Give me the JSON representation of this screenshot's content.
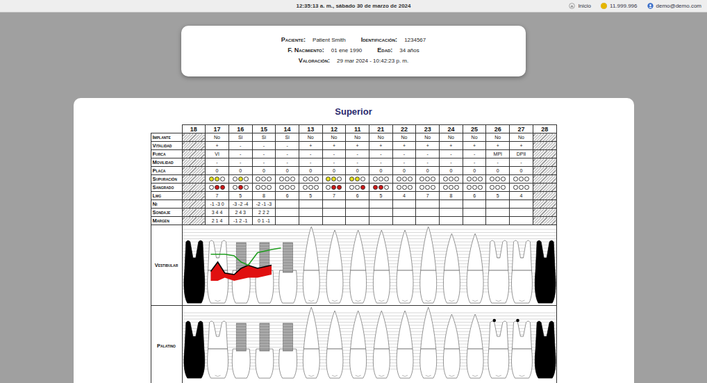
{
  "topbar": {
    "datetime": "12:35:13 a. m., sábado 30 de marzo de 2024",
    "links": [
      {
        "label": "Inicio"
      },
      {
        "label": "11.999.996"
      },
      {
        "label": "demo@demo.com"
      }
    ]
  },
  "patient": {
    "rows": [
      [
        {
          "label": "Paciente:",
          "value": "Patient Smith"
        },
        {
          "label": "Identificación:",
          "value": "1234567"
        }
      ],
      [
        {
          "label": "F. Nacimiento:",
          "value": "01 ene 1990"
        },
        {
          "label": "Edad:",
          "value": "34 años"
        }
      ],
      [
        {
          "label": "Valoración:",
          "value": "29 mar 2024 - 10:42:23 p. m."
        }
      ]
    ]
  },
  "chart": {
    "title": "Superior",
    "teeth": [
      {
        "number": "18",
        "missing": true,
        "kind": "missing",
        "palatal_dot": false
      },
      {
        "number": "17",
        "missing": false,
        "kind": "molar",
        "palatal_dot": false
      },
      {
        "number": "16",
        "missing": false,
        "kind": "implant",
        "palatal_dot": false
      },
      {
        "number": "15",
        "missing": false,
        "kind": "implant",
        "palatal_dot": false
      },
      {
        "number": "14",
        "missing": false,
        "kind": "implant",
        "palatal_dot": false
      },
      {
        "number": "13",
        "missing": false,
        "kind": "canine",
        "palatal_dot": false
      },
      {
        "number": "12",
        "missing": false,
        "kind": "incisor",
        "palatal_dot": false
      },
      {
        "number": "11",
        "missing": false,
        "kind": "incisor",
        "palatal_dot": false
      },
      {
        "number": "21",
        "missing": false,
        "kind": "incisor",
        "palatal_dot": false
      },
      {
        "number": "22",
        "missing": false,
        "kind": "incisor",
        "palatal_dot": false
      },
      {
        "number": "23",
        "missing": false,
        "kind": "canine",
        "palatal_dot": false
      },
      {
        "number": "24",
        "missing": false,
        "kind": "premolar",
        "palatal_dot": false
      },
      {
        "number": "25",
        "missing": false,
        "kind": "premolar",
        "palatal_dot": false
      },
      {
        "number": "26",
        "missing": false,
        "kind": "molar",
        "palatal_dot": true
      },
      {
        "number": "27",
        "missing": false,
        "kind": "molar",
        "palatal_dot": true
      },
      {
        "number": "28",
        "missing": true,
        "kind": "missing",
        "palatal_dot": false
      }
    ],
    "rows": [
      {
        "label": "Implante",
        "kind": "text",
        "cells": [
          null,
          "No",
          "Si",
          "Si",
          "Si",
          "No",
          "No",
          "No",
          "No",
          "No",
          "No",
          "No",
          "No",
          "No",
          "No",
          null
        ]
      },
      {
        "label": "Vitalidad",
        "kind": "text",
        "cells": [
          null,
          "+",
          "-",
          "-",
          "-",
          "+",
          "+",
          "+",
          "+",
          "+",
          "+",
          "+",
          "+",
          "+",
          "+",
          null
        ]
      },
      {
        "label": "Furca",
        "kind": "text",
        "cells": [
          null,
          "VI",
          "-",
          "-",
          "-",
          "-",
          "-",
          "-",
          "-",
          "-",
          "-",
          "-",
          "-",
          "MPI",
          "DPII",
          null
        ]
      },
      {
        "label": "Movilidad",
        "kind": "text",
        "cells": [
          null,
          "-",
          "-",
          "-",
          "-",
          "-",
          "-",
          "-",
          "-",
          "-",
          "-",
          "-",
          "-",
          "-",
          "-",
          null
        ]
      },
      {
        "label": "Placa",
        "kind": "text",
        "cells": [
          null,
          "0",
          "0",
          "0",
          "0",
          "0",
          "0",
          "0",
          "0",
          "0",
          "0",
          "0",
          "0",
          "0",
          "0",
          null
        ]
      },
      {
        "label": "Supuración",
        "kind": "dots",
        "color": "#e6e020",
        "cells": [
          null,
          [
            true,
            true,
            false
          ],
          [
            false,
            true,
            false
          ],
          [
            false,
            false,
            false
          ],
          [
            false,
            false,
            false
          ],
          [
            false,
            false,
            false
          ],
          [
            true,
            true,
            false
          ],
          [
            true,
            true,
            false
          ],
          [
            false,
            false,
            false
          ],
          [
            false,
            false,
            false
          ],
          [
            false,
            false,
            false
          ],
          [
            false,
            false,
            false
          ],
          [
            false,
            false,
            false
          ],
          [
            false,
            false,
            false
          ],
          [
            false,
            false,
            false
          ],
          null
        ]
      },
      {
        "label": "Sangrado",
        "kind": "dots",
        "color": "#d01818",
        "cells": [
          null,
          [
            false,
            true,
            true
          ],
          [
            false,
            true,
            false
          ],
          [
            false,
            false,
            false
          ],
          [
            false,
            false,
            false
          ],
          [
            false,
            false,
            false
          ],
          [
            false,
            true,
            true
          ],
          [
            false,
            false,
            true
          ],
          [
            true,
            true,
            false
          ],
          [
            false,
            false,
            false
          ],
          [
            false,
            false,
            false
          ],
          [
            false,
            false,
            false
          ],
          [
            false,
            false,
            false
          ],
          [
            false,
            false,
            false
          ],
          [
            false,
            false,
            false
          ],
          null
        ]
      },
      {
        "label": "Lmg",
        "kind": "text",
        "cells": [
          null,
          "7",
          "5",
          "8",
          "6",
          "5",
          "7",
          "6",
          "5",
          "4",
          "7",
          "8",
          "6",
          "5",
          "4",
          null
        ]
      },
      {
        "label": "Ni",
        "kind": "text",
        "cells": [
          null,
          "-1 -3 0",
          "-3 -2 -4",
          "-2 -1 -3",
          "",
          "",
          "",
          "",
          "",
          "",
          "",
          "",
          "",
          "",
          "",
          null
        ]
      },
      {
        "label": "Sondaje",
        "kind": "text",
        "cells": [
          null,
          "3 4 4",
          "2 4 3",
          "2 2 2",
          "",
          "",
          "",
          "",
          "",
          "",
          "",
          "",
          "",
          "",
          "",
          null
        ]
      },
      {
        "label": "Margen",
        "kind": "text",
        "cells": [
          null,
          "2 1 4",
          "-1 2 -1",
          "0 1 -1",
          "",
          "",
          "",
          "",
          "",
          "",
          "",
          "",
          "",
          "",
          "",
          null
        ]
      }
    ],
    "views": [
      {
        "label": "Vestibular"
      },
      {
        "label": "Palatino"
      }
    ],
    "series": {
      "start_tooth": "17",
      "lines": [
        {
          "name": "margen",
          "color": "#1f9e1f",
          "values": [
            1.5,
            1.5,
            1.5,
            2,
            4,
            5,
            1,
            0.5,
            0,
            -0.5
          ]
        },
        {
          "name": "insercion",
          "color": "#000000",
          "values": [
            7,
            4,
            7.5,
            8,
            6,
            5,
            6,
            5.5,
            5
          ]
        },
        {
          "name": "hueso",
          "color": "#e01010",
          "values": [
            10,
            10,
            9,
            10,
            9.5,
            9,
            9,
            8.5,
            8
          ]
        }
      ]
    }
  }
}
